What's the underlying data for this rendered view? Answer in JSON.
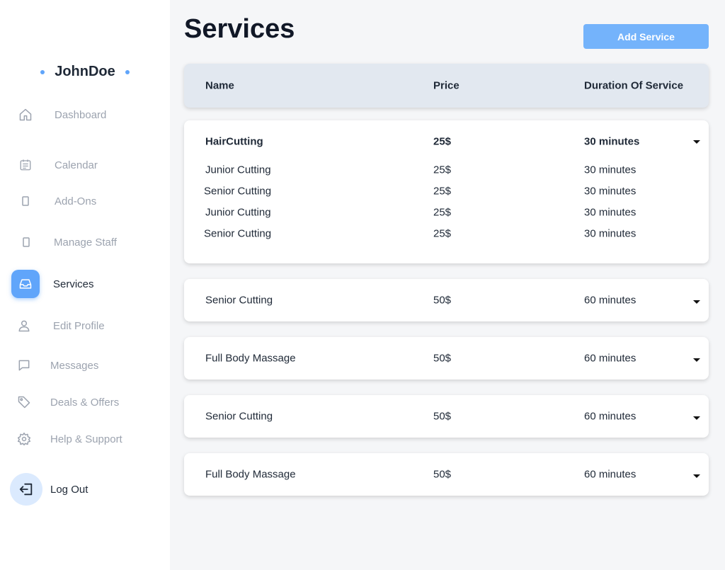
{
  "brand": {
    "name": "JohnDoe"
  },
  "sidebar": {
    "items": [
      {
        "label": "Dashboard",
        "icon": "home-icon"
      },
      {
        "label": "Calendar",
        "icon": "calendar-icon"
      },
      {
        "label": "Add-Ons",
        "icon": "rectangle-icon"
      },
      {
        "label": "Manage Staff",
        "icon": "rectangle-icon"
      },
      {
        "label": "Services",
        "icon": "inbox-icon",
        "active": true
      },
      {
        "label": "Edit Profile",
        "icon": "user-icon"
      },
      {
        "label": "Messages",
        "icon": "message-icon"
      },
      {
        "label": "Deals & Offers",
        "icon": "tag-icon"
      },
      {
        "label": "Help & Support",
        "icon": "gear-icon"
      },
      {
        "label": "Log Out",
        "icon": "logout-icon"
      }
    ]
  },
  "page": {
    "title": "Services",
    "add_button": "Add Service"
  },
  "table": {
    "headers": {
      "name": "Name",
      "price": "Price",
      "duration": "Duration Of Service"
    },
    "groups": [
      {
        "name": "HairCutting",
        "price": "25$",
        "duration": "30 minutes",
        "expanded": true,
        "children": [
          {
            "name": "Junior Cutting",
            "price": "25$",
            "duration": "30 minutes"
          },
          {
            "name": "Senior Cutting",
            "price": "25$",
            "duration": "30 minutes"
          },
          {
            "name": "Junior Cutting",
            "price": "25$",
            "duration": "30 minutes"
          },
          {
            "name": "Senior Cutting",
            "price": "25$",
            "duration": "30 minutes"
          }
        ]
      },
      {
        "name": "Senior Cutting",
        "price": "50$",
        "duration": "60 minutes"
      },
      {
        "name": "Full Body Massage",
        "price": "50$",
        "duration": "60 minutes"
      },
      {
        "name": "Senior Cutting",
        "price": "50$",
        "duration": "60 minutes"
      },
      {
        "name": "Full Body Massage",
        "price": "50$",
        "duration": "60 minutes"
      }
    ]
  },
  "colors": {
    "accent": "#60a5fa",
    "button": "#74b3fb",
    "header_bg": "#e2e8f0",
    "page_bg": "#f5f6f8"
  }
}
